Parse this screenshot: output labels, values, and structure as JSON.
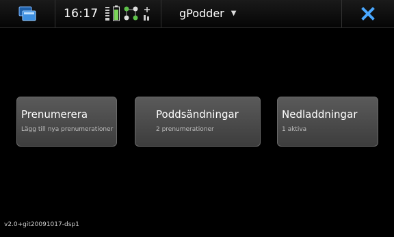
{
  "statusbar": {
    "clock": "16:17"
  },
  "header": {
    "app_title": "gPodder"
  },
  "buttons": [
    {
      "label": "Prenumerera",
      "subtitle": "Lägg till nya prenumerationer"
    },
    {
      "label": "Poddsändningar",
      "subtitle": "2 prenumerationer"
    },
    {
      "label": "Nedladdningar",
      "subtitle": "1 aktiva"
    }
  ],
  "footer": {
    "version": "v2.0+git20091017-dsp1"
  },
  "colors": {
    "background": "#000000",
    "button": "#4a4a4a",
    "close_icon": "#4aa8ff",
    "task_icon": "#3d8fe0"
  }
}
